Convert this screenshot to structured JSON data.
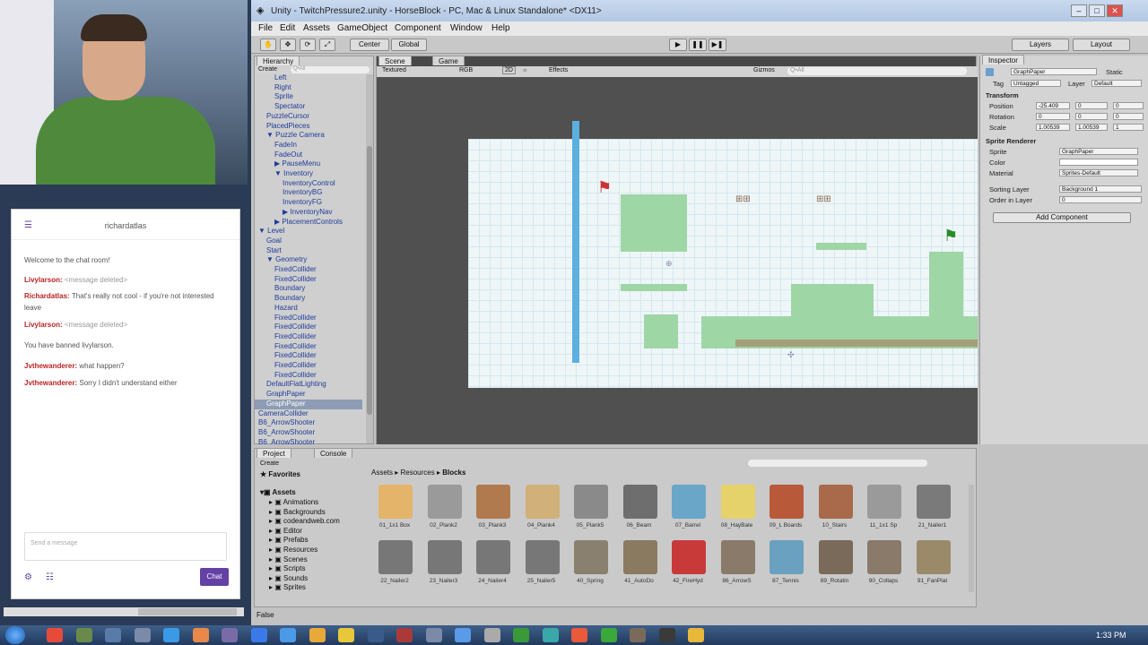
{
  "chat": {
    "channel": "richardatlas",
    "messages": [
      {
        "user": "",
        "text": "Welcome to the chat room!",
        "deleted": false
      },
      {
        "user": "Livylarson",
        "text": "<message deleted>",
        "deleted": true
      },
      {
        "user": "Richardatlas",
        "text": "That's really not cool - if you're not interested leave",
        "deleted": false
      },
      {
        "user": "Livylarson",
        "text": "<message deleted>",
        "deleted": true
      },
      {
        "user": "",
        "text": "You have banned livylarson.",
        "deleted": false
      },
      {
        "user": "Jvthewanderer",
        "text": "what happen?",
        "deleted": false
      },
      {
        "user": "Jvthewanderer",
        "text": "Sorry I didn't understand either",
        "deleted": false
      }
    ],
    "input_placeholder": "Send a message",
    "send_label": "Chat"
  },
  "unity": {
    "title": "Unity - TwitchPressure2.unity - HorseBlock - PC, Mac & Linux Standalone* <DX11>",
    "menu": [
      "File",
      "Edit",
      "Assets",
      "GameObject",
      "Component",
      "Window",
      "Help"
    ],
    "toolbar": {
      "pivot": "Center",
      "space": "Global",
      "layers": "Layers",
      "layout": "Layout"
    },
    "hierarchy": {
      "tab": "Hierarchy",
      "create": "Create",
      "search": "Q•All",
      "items": [
        {
          "label": "Left",
          "depth": 2
        },
        {
          "label": "Right",
          "depth": 2
        },
        {
          "label": "Sprite",
          "depth": 2
        },
        {
          "label": "Spectator",
          "depth": 2
        },
        {
          "label": "PuzzleCursor",
          "depth": 1
        },
        {
          "label": "PlacedPieces",
          "depth": 1
        },
        {
          "label": "▼ Puzzle Camera",
          "depth": 1
        },
        {
          "label": "FadeIn",
          "depth": 2
        },
        {
          "label": "FadeOut",
          "depth": 2
        },
        {
          "label": "▶ PauseMenu",
          "depth": 2
        },
        {
          "label": "▼ Inventory",
          "depth": 2
        },
        {
          "label": "InventoryControl",
          "depth": 3
        },
        {
          "label": "InventoryBG",
          "depth": 3
        },
        {
          "label": "InventoryFG",
          "depth": 3
        },
        {
          "label": "▶ InventoryNav",
          "depth": 3
        },
        {
          "label": "▶ PlacementControls",
          "depth": 2
        },
        {
          "label": "▼ Level",
          "depth": 0
        },
        {
          "label": "Goal",
          "depth": 1
        },
        {
          "label": "Start",
          "depth": 1
        },
        {
          "label": "▼ Geometry",
          "depth": 1
        },
        {
          "label": "FixedCollider",
          "depth": 2
        },
        {
          "label": "FixedCollider",
          "depth": 2
        },
        {
          "label": "Boundary",
          "depth": 2
        },
        {
          "label": "Boundary",
          "depth": 2
        },
        {
          "label": "Hazard",
          "depth": 2
        },
        {
          "label": "FixedCollider",
          "depth": 2
        },
        {
          "label": "FixedCollider",
          "depth": 2
        },
        {
          "label": "FixedCollider",
          "depth": 2
        },
        {
          "label": "FixedCollider",
          "depth": 2
        },
        {
          "label": "FixedCollider",
          "depth": 2
        },
        {
          "label": "FixedCollider",
          "depth": 2
        },
        {
          "label": "FixedCollider",
          "depth": 2
        },
        {
          "label": "DefaultFlatLighting",
          "depth": 1
        },
        {
          "label": "GraphPaper",
          "depth": 1
        },
        {
          "label": "GraphPaper",
          "depth": 1,
          "selected": true
        },
        {
          "label": "CameraCollider",
          "depth": 0
        },
        {
          "label": "B6_ArrowShooter",
          "depth": 0
        },
        {
          "label": "B6_ArrowShooter",
          "depth": 0
        },
        {
          "label": "B6_ArrowShooter",
          "depth": 0
        }
      ]
    },
    "scene": {
      "tabs": [
        "Scene",
        "Game"
      ],
      "shading": "Textured",
      "color_mode": "RGB",
      "mode_2d": "2D",
      "effects": "Effects",
      "gizmos": "Gizmos",
      "search": "Q•All"
    },
    "inspector": {
      "tab": "Inspector",
      "object_name": "GraphPaper",
      "static_label": "Static",
      "tag_label": "Tag",
      "tag_value": "Untagged",
      "layer_label": "Layer",
      "layer_value": "Default",
      "transform_title": "Transform",
      "position_label": "Position",
      "position": {
        "x": "-25.409",
        "y": "0",
        "z": "0"
      },
      "rotation_label": "Rotation",
      "rotation": {
        "x": "0",
        "y": "0",
        "z": "0"
      },
      "scale_label": "Scale",
      "scale": {
        "x": "1.00539",
        "y": "1.00539",
        "z": "1"
      },
      "renderer_title": "Sprite Renderer",
      "sprite_label": "Sprite",
      "sprite_value": "GraphPaper",
      "color_label": "Color",
      "material_label": "Material",
      "material_value": "Sprites-Default",
      "sorting_layer_label": "Sorting Layer",
      "sorting_layer_value": "Background 1",
      "order_label": "Order in Layer",
      "order_value": "0",
      "add_component": "Add Component"
    },
    "project": {
      "tabs": [
        "Project",
        "Console"
      ],
      "create": "Create",
      "breadcrumb": [
        "Assets",
        "Resources",
        "Blocks"
      ],
      "favorites": "Favorites",
      "assets_root": "Assets",
      "folders": [
        "Animations",
        "Backgrounds",
        "codeandweb.com",
        "Editor",
        "Prefabs",
        "Resources",
        "Scenes",
        "Scripts",
        "Sounds",
        "Sprites"
      ],
      "row1": [
        {
          "name": "01_1x1 Box",
          "color": "#e3b46a"
        },
        {
          "name": "02_Plank2",
          "color": "#9a9a9a"
        },
        {
          "name": "03_Plank3",
          "color": "#b07a4e"
        },
        {
          "name": "04_Plank4",
          "color": "#d2b07a"
        },
        {
          "name": "05_Plank5",
          "color": "#8a8a8a"
        },
        {
          "name": "06_Beam",
          "color": "#6e6e6e"
        },
        {
          "name": "07_Barrel",
          "color": "#6aa6c8"
        },
        {
          "name": "08_HayBale",
          "color": "#e6d26a"
        },
        {
          "name": "09_L Boards",
          "color": "#b85a3a"
        },
        {
          "name": "10_Stairs",
          "color": "#a86a4a"
        },
        {
          "name": "11_1x1 Sp",
          "color": "#9a9a9a"
        },
        {
          "name": "21_Nailer1",
          "color": "#7a7a7a"
        }
      ],
      "row2": [
        {
          "name": "22_Nailer2",
          "color": "#777777"
        },
        {
          "name": "23_Nailer3",
          "color": "#777777"
        },
        {
          "name": "24_Nailer4",
          "color": "#777777"
        },
        {
          "name": "25_Nailer5",
          "color": "#777777"
        },
        {
          "name": "40_Spring",
          "color": "#8a8070"
        },
        {
          "name": "41_AutoDo",
          "color": "#8a7a60"
        },
        {
          "name": "42_FireHyd",
          "color": "#c83a3a"
        },
        {
          "name": "86_ArrowS",
          "color": "#8a7a6a"
        },
        {
          "name": "87_Tennis",
          "color": "#6aa0c0"
        },
        {
          "name": "89_Rotatin",
          "color": "#7a6a5a"
        },
        {
          "name": "90_Collaps",
          "color": "#8a7a6a"
        },
        {
          "name": "91_FanPlat",
          "color": "#9a8a6a"
        }
      ]
    },
    "status_text": "False"
  },
  "taskbar": {
    "clock": "1:33 PM"
  }
}
